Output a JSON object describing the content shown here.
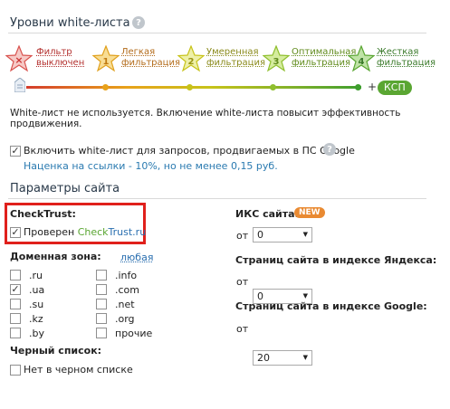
{
  "levels": {
    "title": "Уровни white-листа",
    "items": [
      {
        "num": "",
        "label_line1": "Фильтр",
        "label_line2": "выключен",
        "color": "#d9534f"
      },
      {
        "num": "1",
        "label_line1": "Легкая",
        "label_line2": "фильтрация",
        "color": "#f0b03a"
      },
      {
        "num": "2",
        "label_line1": "Умеренная",
        "label_line2": "фильтрация",
        "color": "#d7d244"
      },
      {
        "num": "3",
        "label_line1": "Оптимальная",
        "label_line2": "фильтрация",
        "color": "#a8d04a"
      },
      {
        "num": "4",
        "label_line1": "Жесткая",
        "label_line2": "фильтрация",
        "color": "#7cc45a"
      }
    ],
    "plus": "+",
    "ksp_label": "КСП",
    "description": "White-лист не используется. Включение white-листа повысит эффективность продвижения.",
    "enable_label": "Включить white-лист для запросов, продвигаемых в ПС Google",
    "markup_note": "Наценка на ссылки - 10%, но не менее 0,15 руб."
  },
  "params": {
    "title": "Параметры сайта",
    "checktrust_title": "CheckTrust:",
    "checktrust_prefix": "Проверен ",
    "checktrust_brand_a": "Check",
    "checktrust_brand_b": "Trust.ru",
    "domain_title": "Доменная зона:",
    "domain_any": "любая",
    "zones_left": [
      {
        "label": ".ru",
        "checked": false
      },
      {
        "label": ".ua",
        "checked": true
      },
      {
        "label": ".su",
        "checked": false
      },
      {
        "label": ".kz",
        "checked": false
      },
      {
        "label": ".by",
        "checked": false
      }
    ],
    "zones_right": [
      {
        "label": ".info",
        "checked": false
      },
      {
        "label": ".com",
        "checked": false
      },
      {
        "label": ".net",
        "checked": false
      },
      {
        "label": ".org",
        "checked": false
      },
      {
        "label": "прочие",
        "checked": false
      }
    ],
    "blacklist_title": "Черный список:",
    "blacklist_label": "Нет в черном списке",
    "iks_title": "ИКС сайта:",
    "new_badge": "NEW",
    "iks_from": "от",
    "iks_value": "0",
    "yandex_title": "Страниц сайта в индексе Яндекса:",
    "yandex_from": "от",
    "yandex_value": "0",
    "google_title": "Страниц сайта в индексе Google:",
    "google_from": "от",
    "google_value": "20"
  },
  "colors": {
    "highlight_box": "#e0201c",
    "link_blue": "#2a6fb0",
    "brand_green": "#5aa632"
  }
}
